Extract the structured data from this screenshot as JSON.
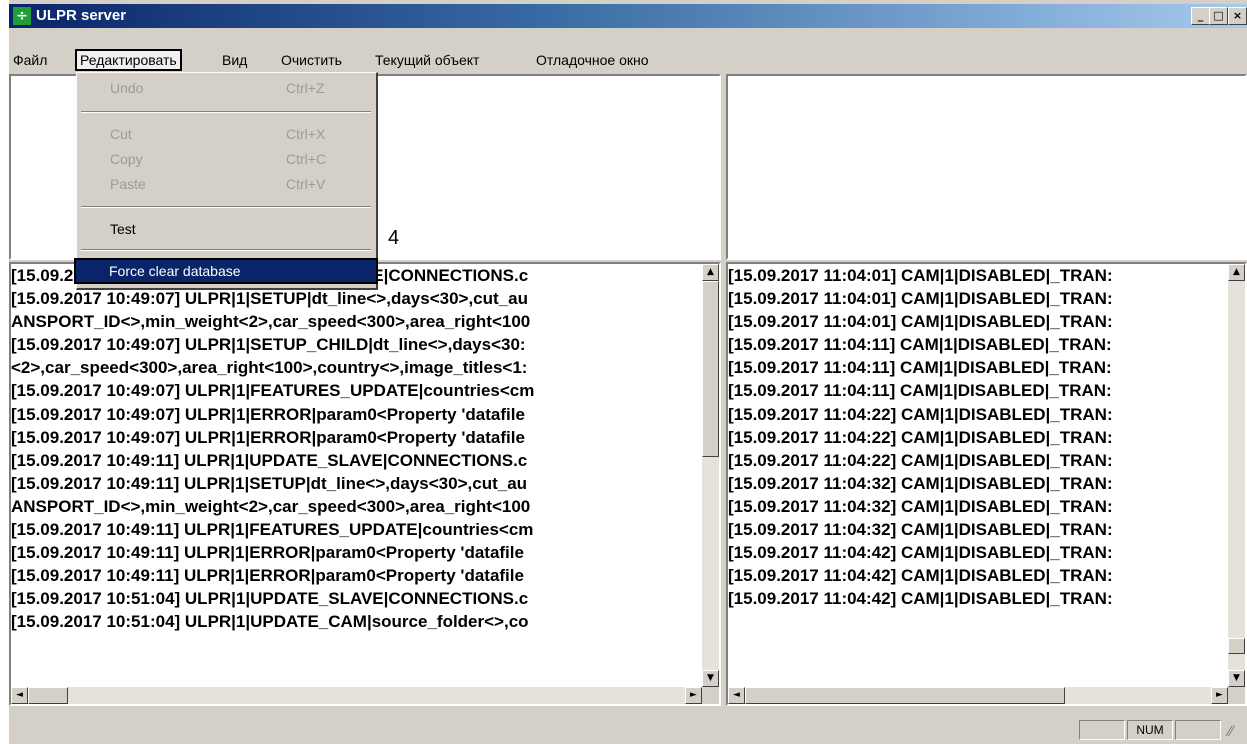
{
  "window": {
    "title": "ULPR server",
    "icon": "app-icon",
    "minimize": "_",
    "maximize": "□",
    "close": "×"
  },
  "menu": {
    "items": [
      "Файл",
      "Редактировать",
      "Вид",
      "Очистить",
      "Текущий объект",
      "Отладочное окно"
    ],
    "active": "Редактировать"
  },
  "dropdown": {
    "undo": {
      "label": "Undo",
      "shortcut": "Ctrl+Z"
    },
    "cut": {
      "label": "Cut",
      "shortcut": "Ctrl+X"
    },
    "copy": {
      "label": "Copy",
      "shortcut": "Ctrl+C"
    },
    "paste": {
      "label": "Paste",
      "shortcut": "Ctrl+V"
    },
    "test": {
      "label": "Test"
    },
    "force_clear": {
      "label": "Force clear database"
    }
  },
  "callout": "4",
  "left_log": [
    "[15.09.2017 10:49:07] ULPR|1|UPDATE_SLAVE|CONNECTIONS.c",
    "[15.09.2017 10:49:07] ULPR|1|SETUP|dt_line<>,days<30>,cut_au",
    "ANSPORT_ID<>,min_weight<2>,car_speed<300>,area_right<100",
    "[15.09.2017 10:49:07] ULPR|1|SETUP_CHILD|dt_line<>,days<30:",
    "<2>,car_speed<300>,area_right<100>,country<>,image_titles<1:",
    "[15.09.2017 10:49:07] ULPR|1|FEATURES_UPDATE|countries<cm",
    "[15.09.2017 10:49:07] ULPR|1|ERROR|param0<Property 'datafile",
    "[15.09.2017 10:49:07] ULPR|1|ERROR|param0<Property 'datafile",
    "[15.09.2017 10:49:11] ULPR|1|UPDATE_SLAVE|CONNECTIONS.c",
    "[15.09.2017 10:49:11] ULPR|1|SETUP|dt_line<>,days<30>,cut_au",
    "ANSPORT_ID<>,min_weight<2>,car_speed<300>,area_right<100",
    "[15.09.2017 10:49:11] ULPR|1|FEATURES_UPDATE|countries<cm",
    "[15.09.2017 10:49:11] ULPR|1|ERROR|param0<Property 'datafile",
    "[15.09.2017 10:49:11] ULPR|1|ERROR|param0<Property 'datafile",
    "[15.09.2017 10:51:04] ULPR|1|UPDATE_SLAVE|CONNECTIONS.c",
    "[15.09.2017 10:51:04] ULPR|1|UPDATE_CAM|source_folder<>,co"
  ],
  "right_log": [
    "[15.09.2017 11:04:01] CAM|1|DISABLED|_TRAN:",
    "[15.09.2017 11:04:01] CAM|1|DISABLED|_TRAN:",
    "[15.09.2017 11:04:01] CAM|1|DISABLED|_TRAN:",
    "[15.09.2017 11:04:11] CAM|1|DISABLED|_TRAN:",
    "[15.09.2017 11:04:11] CAM|1|DISABLED|_TRAN:",
    "[15.09.2017 11:04:11] CAM|1|DISABLED|_TRAN:",
    "[15.09.2017 11:04:22] CAM|1|DISABLED|_TRAN:",
    "[15.09.2017 11:04:22] CAM|1|DISABLED|_TRAN:",
    "[15.09.2017 11:04:22] CAM|1|DISABLED|_TRAN:",
    "[15.09.2017 11:04:32] CAM|1|DISABLED|_TRAN:",
    "[15.09.2017 11:04:32] CAM|1|DISABLED|_TRAN:",
    "[15.09.2017 11:04:32] CAM|1|DISABLED|_TRAN:",
    "[15.09.2017 11:04:42] CAM|1|DISABLED|_TRAN:",
    "[15.09.2017 11:04:42] CAM|1|DISABLED|_TRAN:",
    "[15.09.2017 11:04:42] CAM|1|DISABLED|_TRAN:"
  ],
  "scroll": {
    "up": "▲",
    "down": "▼",
    "left": "◄",
    "right": "►"
  },
  "status": {
    "num": "NUM"
  },
  "colors": {
    "title_start": "#0a246a",
    "title_end": "#a6caf0",
    "highlight": "#0a246a",
    "face": "#d4d0c8"
  }
}
